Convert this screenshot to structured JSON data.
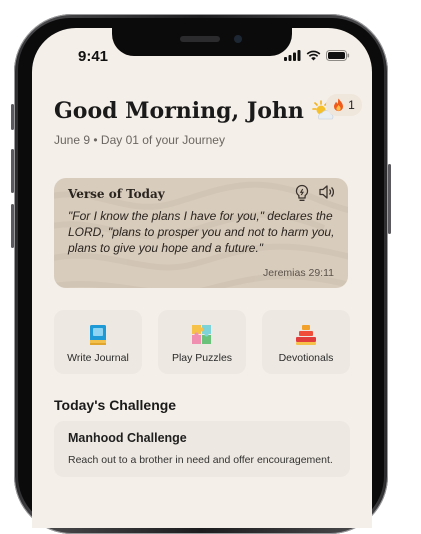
{
  "status_bar": {
    "time": "9:41"
  },
  "header": {
    "greeting": "Good Morning, John",
    "subline": "June 9 • Day 01 of your Journey",
    "streak_count": "1"
  },
  "verse": {
    "title": "Verse of Today",
    "text": "\"For I know the plans I have for you,\" declares the LORD, \"plans to prosper you and not to harm you, plans to give you hope and a future.\"",
    "reference": "Jeremias 29:11"
  },
  "quick_actions": [
    {
      "label": "Write Journal",
      "icon": "book-icon"
    },
    {
      "label": "Play Puzzles",
      "icon": "puzzle-icon"
    },
    {
      "label": "Devotionals",
      "icon": "stacked-books-icon"
    }
  ],
  "challenge_section": {
    "title": "Today's Challenge",
    "card_title": "Manhood Challenge",
    "card_text": "Reach out to a brother in need and offer encouragement."
  },
  "colors": {
    "background": "#f4efe8",
    "card": "#ede8e1",
    "verse_card": "#d8ccbd",
    "flame": "#f05a1a"
  }
}
